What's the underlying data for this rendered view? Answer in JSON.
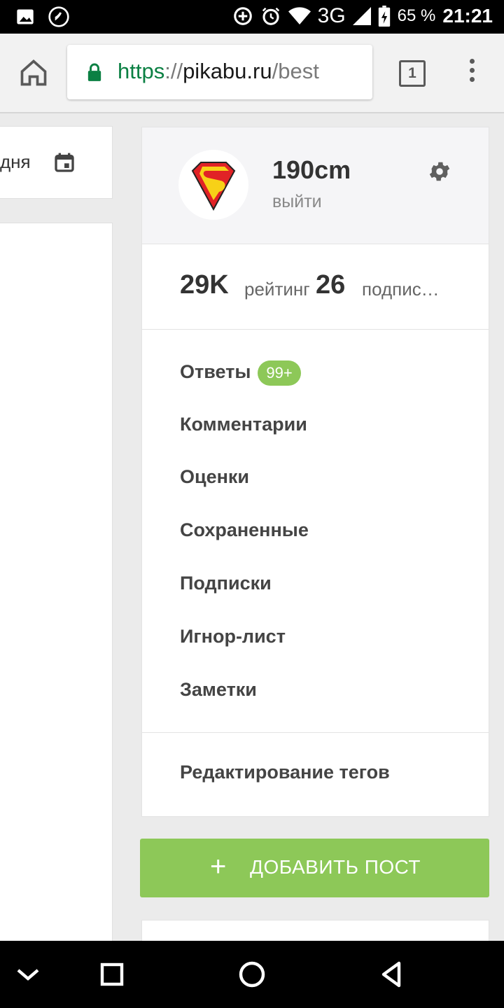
{
  "status_bar": {
    "network": "3G",
    "battery": "65 %",
    "time": "21:21",
    "icons": [
      "image-icon",
      "phone-call-icon",
      "add-circle-icon",
      "alarm-icon",
      "wifi-icon",
      "signal-icon",
      "battery-charging-icon"
    ]
  },
  "browser": {
    "url_scheme": "https",
    "url_sep": "://",
    "url_host": "pikabu.ru",
    "url_path": "/best",
    "tab_count": "1"
  },
  "left_panel": {
    "day_text": "дня"
  },
  "profile": {
    "username": "190cm",
    "logout": "выйти",
    "rating_value": "29K",
    "rating_label": "рейтинг",
    "subs_value": "26",
    "subs_label": "подписчиков"
  },
  "menu": {
    "items": [
      {
        "label": "Ответы",
        "badge": "99+"
      },
      {
        "label": "Комментарии"
      },
      {
        "label": "Оценки"
      },
      {
        "label": "Сохраненные"
      },
      {
        "label": "Подписки"
      },
      {
        "label": "Игнор-лист"
      },
      {
        "label": "Заметки"
      }
    ],
    "edit_tags": "Редактирование тегов"
  },
  "actions": {
    "add_post": "ДОБАВИТЬ ПОСТ"
  },
  "colors": {
    "accent_green": "#8dc858",
    "secure_green": "#0b8043"
  }
}
